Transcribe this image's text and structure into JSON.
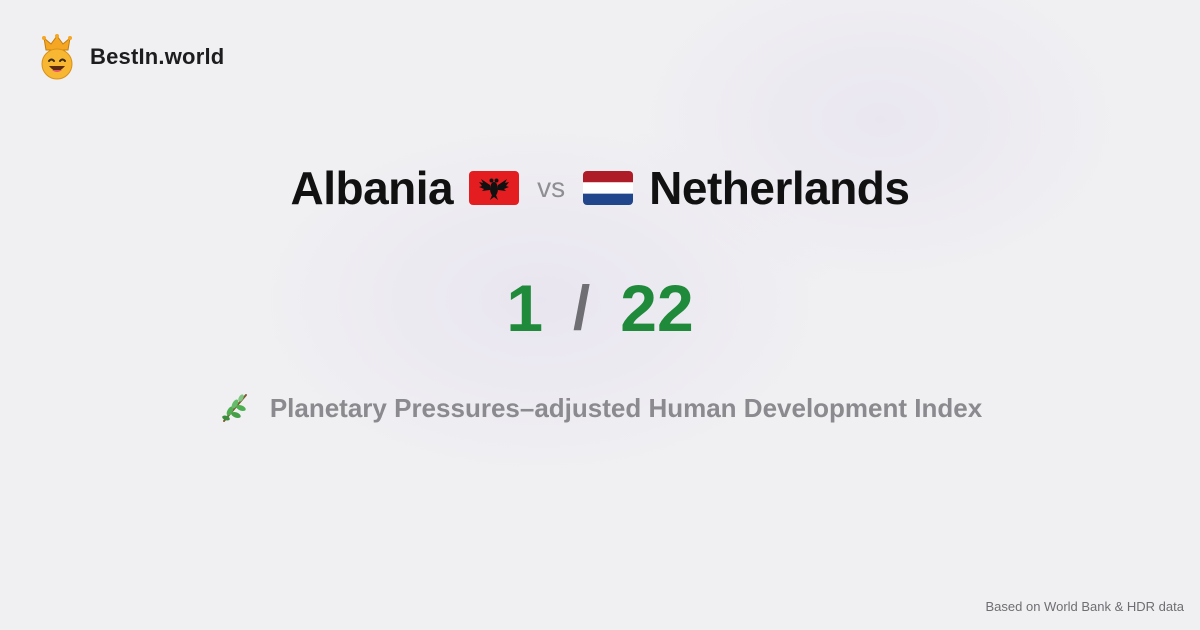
{
  "brand": {
    "name": "BestIn.world",
    "logo_icon": "crowned-smiley-icon"
  },
  "comparison": {
    "country_a": "Albania",
    "country_a_flag": "albania-flag-icon",
    "vs_label": "vs",
    "country_b": "Netherlands",
    "country_b_flag": "netherlands-flag-icon"
  },
  "ranks": {
    "rank_a": "1",
    "separator": "/",
    "rank_b": "22"
  },
  "metric": {
    "icon": "herb-icon",
    "label": "Planetary Pressures–adjusted Human Development Index"
  },
  "footer": {
    "source": "Based on World Bank & HDR data"
  },
  "colors": {
    "rank_color": "#1f8a3a",
    "albania_red": "#e41e20",
    "netherlands_red": "#ae1c28",
    "netherlands_blue": "#21468b"
  }
}
